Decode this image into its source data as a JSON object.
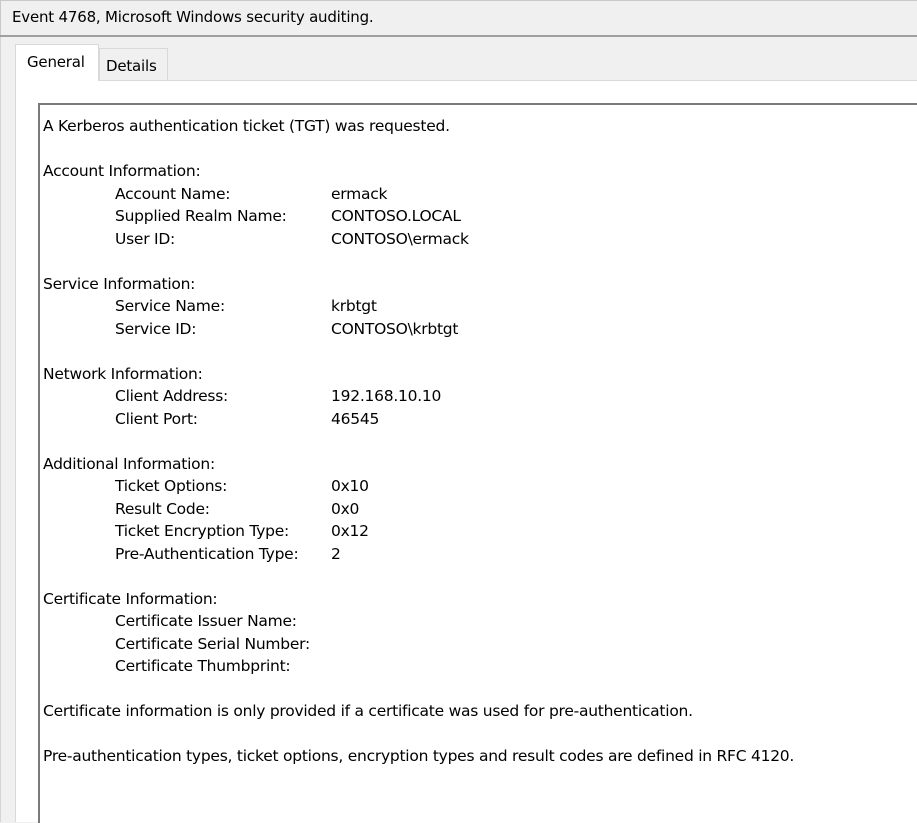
{
  "window": {
    "title": "Event 4768, Microsoft Windows security auditing."
  },
  "tabs": [
    {
      "label": "General",
      "selected": true
    },
    {
      "label": "Details",
      "selected": false
    }
  ],
  "event": {
    "summary": "A Kerberos authentication ticket (TGT) was requested.",
    "sections": [
      {
        "heading": "Account Information:",
        "fields": [
          {
            "label": "Account Name:",
            "value": "ermack"
          },
          {
            "label": "Supplied Realm Name:",
            "value": "CONTOSO.LOCAL"
          },
          {
            "label": "User ID:",
            "value": "CONTOSO\\ermack"
          }
        ]
      },
      {
        "heading": "Service Information:",
        "fields": [
          {
            "label": "Service Name:",
            "value": "krbtgt"
          },
          {
            "label": "Service ID:",
            "value": "CONTOSO\\krbtgt"
          }
        ]
      },
      {
        "heading": "Network Information:",
        "fields": [
          {
            "label": "Client Address:",
            "value": "192.168.10.10"
          },
          {
            "label": "Client Port:",
            "value": "46545"
          }
        ]
      },
      {
        "heading": "Additional Information:",
        "fields": [
          {
            "label": "Ticket Options:",
            "value": "0x10"
          },
          {
            "label": "Result Code:",
            "value": "0x0"
          },
          {
            "label": "Ticket Encryption Type:",
            "value": "0x12"
          },
          {
            "label": "Pre-Authentication Type:",
            "value": "2"
          }
        ]
      },
      {
        "heading": "Certificate Information:",
        "fields": [
          {
            "label": "Certificate Issuer Name:",
            "value": ""
          },
          {
            "label": "Certificate Serial Number:",
            "value": ""
          },
          {
            "label": "Certificate Thumbprint:",
            "value": ""
          }
        ]
      }
    ],
    "note_certificate": "Certificate information is only provided if a certificate was used for pre-authentication.",
    "note_rfc": "Pre-authentication types, ticket options, encryption types and result codes are defined in RFC 4120."
  },
  "colors": {
    "window_bg": "#f0f0f0",
    "panel_bg": "#ffffff",
    "textbox_border": "#7a7a7a"
  }
}
